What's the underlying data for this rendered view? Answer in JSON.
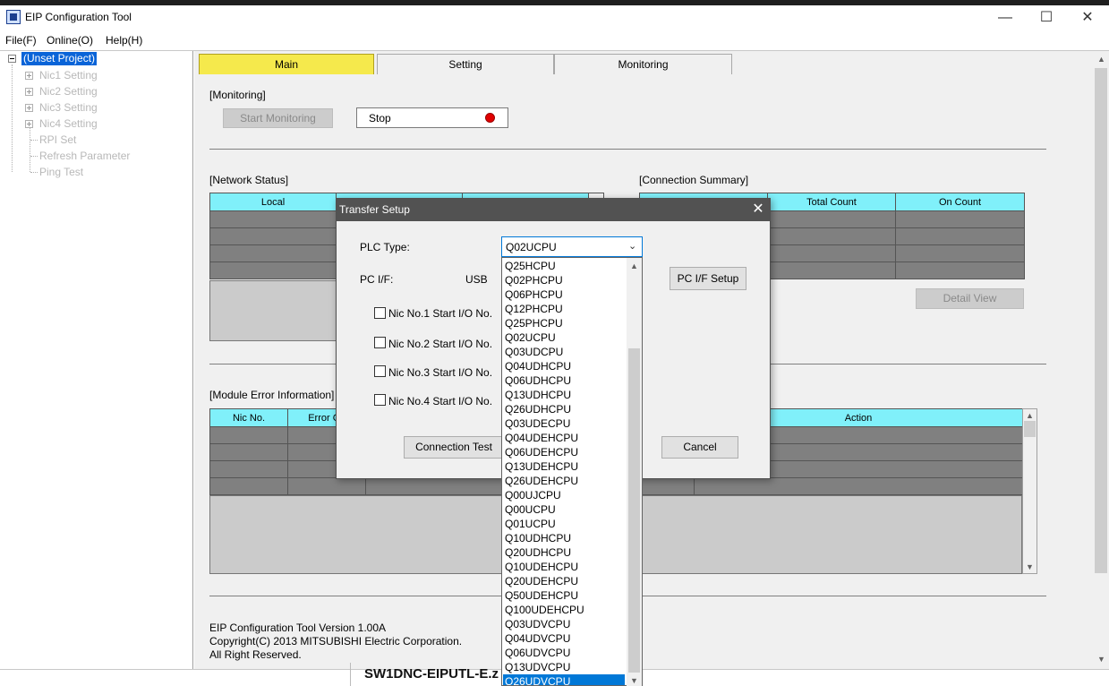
{
  "window": {
    "title": "EIP Configuration Tool",
    "minimize": "—",
    "maximize": "☐",
    "close": "✕"
  },
  "menu": [
    "File(F)",
    "Online(O)",
    "Help(H)"
  ],
  "tree": {
    "root": "(Unset Project)",
    "items": [
      "Nic1 Setting",
      "Nic2 Setting",
      "Nic3 Setting",
      "Nic4 Setting",
      "RPI Set",
      "Refresh Parameter",
      "Ping Test"
    ]
  },
  "tabs": [
    "Main",
    "Setting",
    "Monitoring"
  ],
  "monitoring": {
    "label": "[Monitoring]",
    "start_button": "Start Monitoring",
    "status_text": "Stop",
    "status_color": "#e00000"
  },
  "network_status": {
    "label": "[Network Status]",
    "columns": [
      "Local",
      "",
      ""
    ]
  },
  "connection_summary": {
    "label": "[Connection Summary]",
    "columns": [
      "",
      "Total Count",
      "On Count"
    ],
    "detail_button": "Detail View"
  },
  "module_error": {
    "label": "[Module Error Information]",
    "columns": [
      "Nic No.",
      "Error Co",
      "",
      "",
      "Action"
    ]
  },
  "footer": {
    "version": "EIP Configuration Tool Version 1.00A",
    "copyright": "Copyright(C) 2013 MITSUBISHI Electric Corporation.",
    "rights": "All Right Reserved."
  },
  "dialog": {
    "title": "Transfer Setup",
    "plc_type_label": "PLC Type:",
    "plc_type_value": "Q02UCPU",
    "pc_if_label": "PC I/F:",
    "pc_if_value": "USB",
    "pc_if_setup_button": "PC I/F Setup",
    "nic_options": [
      "Nic No.1 Start I/O No.",
      "Nic No.2 Start I/O No.",
      "Nic No.3 Start I/O No.",
      "Nic No.4 Start I/O No."
    ],
    "connection_test_button": "Connection Test",
    "cancel_button": "Cancel"
  },
  "dropdown": {
    "items": [
      "Q25HCPU",
      "Q02PHCPU",
      "Q06PHCPU",
      "Q12PHCPU",
      "Q25PHCPU",
      "Q02UCPU",
      "Q03UDCPU",
      "Q04UDHCPU",
      "Q06UDHCPU",
      "Q13UDHCPU",
      "Q26UDHCPU",
      "Q03UDECPU",
      "Q04UDEHCPU",
      "Q06UDEHCPU",
      "Q13UDEHCPU",
      "Q26UDEHCPU",
      "Q00UJCPU",
      "Q00UCPU",
      "Q01UCPU",
      "Q10UDHCPU",
      "Q20UDHCPU",
      "Q10UDEHCPU",
      "Q20UDEHCPU",
      "Q50UDEHCPU",
      "Q100UDEHCPU",
      "Q03UDVCPU",
      "Q04UDVCPU",
      "Q06UDVCPU",
      "Q13UDVCPU",
      "Q26UDVCPU"
    ],
    "selected": "Q26UDVCPU"
  },
  "taskbar_fragment": "SW1DNC-EIPUTL-E.z"
}
